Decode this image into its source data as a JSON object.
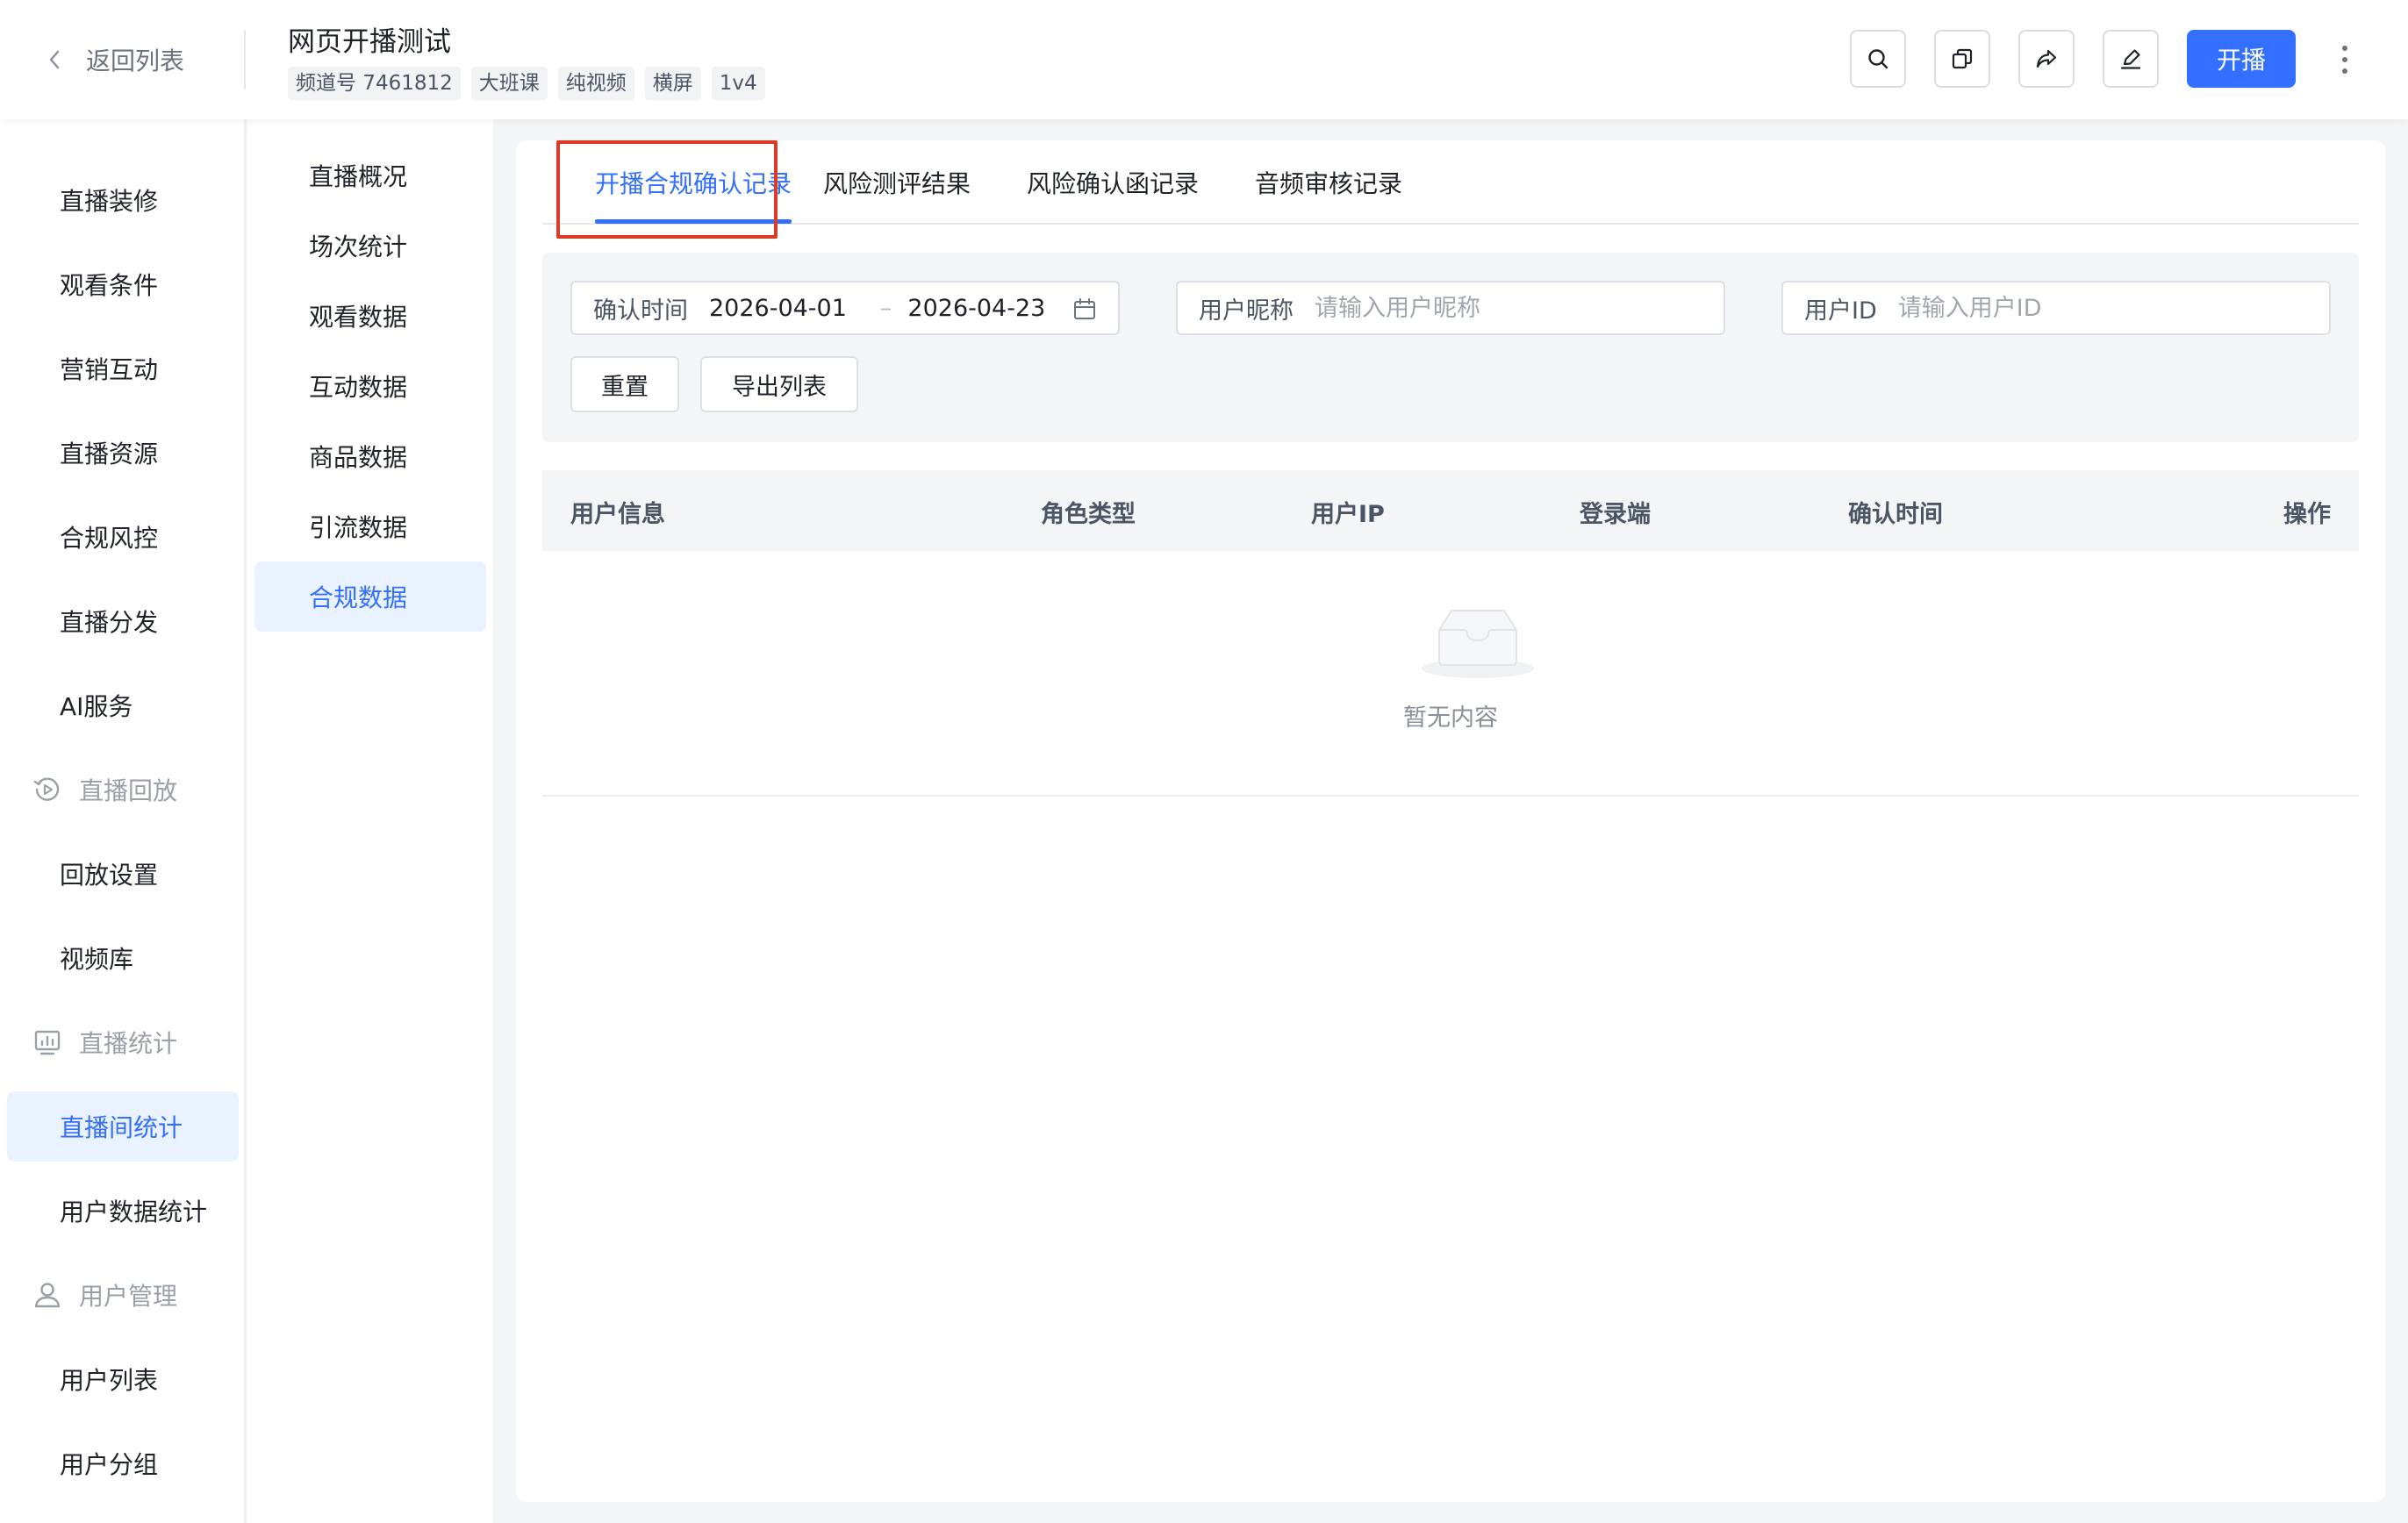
{
  "header": {
    "back_label": "返回列表",
    "title": "网页开播测试",
    "tags": [
      "频道号 7461812",
      "大班课",
      "纯视频",
      "横屏",
      "1v4"
    ],
    "live_button": "开播",
    "icons": [
      "search-icon",
      "copy-icon",
      "share-icon",
      "edit-icon",
      "more-icon"
    ]
  },
  "sidebar": {
    "items": [
      {
        "label": "直播装修",
        "type": "item"
      },
      {
        "label": "观看条件",
        "type": "item"
      },
      {
        "label": "营销互动",
        "type": "item"
      },
      {
        "label": "直播资源",
        "type": "item"
      },
      {
        "label": "合规风控",
        "type": "item"
      },
      {
        "label": "直播分发",
        "type": "item"
      },
      {
        "label": "AI服务",
        "type": "item"
      },
      {
        "label": "直播回放",
        "type": "group",
        "icon": "replay-icon"
      },
      {
        "label": "回放设置",
        "type": "item"
      },
      {
        "label": "视频库",
        "type": "item"
      },
      {
        "label": "直播统计",
        "type": "group",
        "icon": "statistics-icon"
      },
      {
        "label": "直播间统计",
        "type": "item",
        "active": true
      },
      {
        "label": "用户数据统计",
        "type": "item"
      },
      {
        "label": "用户管理",
        "type": "group",
        "icon": "user-icon"
      },
      {
        "label": "用户列表",
        "type": "item"
      },
      {
        "label": "用户分组",
        "type": "item"
      }
    ]
  },
  "subnav": {
    "items": [
      "直播概况",
      "场次统计",
      "观看数据",
      "互动数据",
      "商品数据",
      "引流数据",
      "合规数据"
    ],
    "active_index": 6
  },
  "tabs": {
    "items": [
      "开播合规确认记录",
      "风险测评结果",
      "风险确认函记录",
      "音频审核记录"
    ],
    "active_index": 0
  },
  "filters": {
    "date": {
      "label": "确认时间",
      "start": "2026-04-01",
      "separator": "–",
      "end": "2026-04-23"
    },
    "nickname": {
      "label": "用户昵称",
      "placeholder": "请输入用户昵称",
      "value": ""
    },
    "user_id": {
      "label": "用户ID",
      "placeholder": "请输入用户ID",
      "value": ""
    },
    "reset_button": "重置",
    "export_button": "导出列表"
  },
  "table": {
    "columns": [
      "用户信息",
      "角色类型",
      "用户IP",
      "登录端",
      "确认时间",
      "操作"
    ],
    "rows": [],
    "empty_text": "暂无内容"
  },
  "colors": {
    "accent": "#3370ff",
    "highlight_border": "#dc3b26",
    "active_bg": "#eaf1ff"
  }
}
